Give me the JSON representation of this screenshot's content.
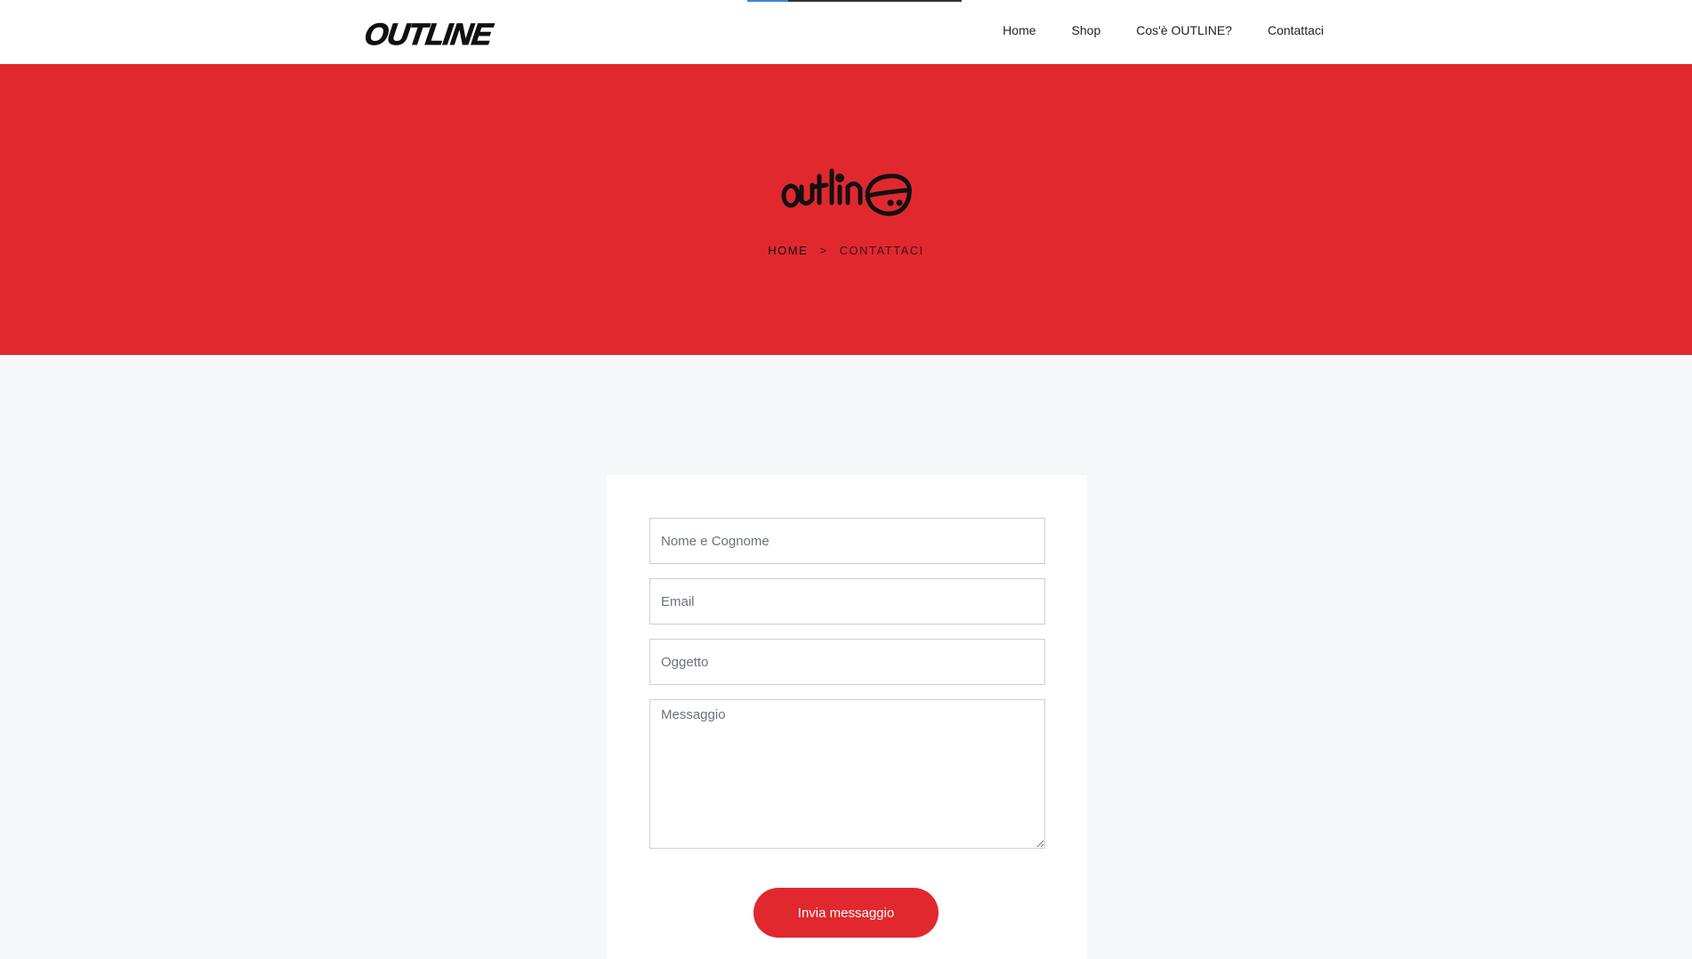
{
  "header": {
    "logo_text": "OUTLINE",
    "progress_fraction": 0.19,
    "nav": [
      {
        "label": "Home"
      },
      {
        "label": "Shop"
      },
      {
        "label": "Cos'è OUTLINE?"
      },
      {
        "label": "Contattaci"
      }
    ]
  },
  "hero": {
    "background_color": "#e1282f",
    "logo_name": "outline-graffiti-logo",
    "breadcrumb": {
      "home": "HOME",
      "separator": ">",
      "current": "CONTATTACI"
    }
  },
  "form": {
    "name_placeholder": "Nome e Cognome",
    "email_placeholder": "Email",
    "subject_placeholder": "Oggetto",
    "message_placeholder": "Messaggio",
    "submit_label": "Invia messaggio"
  },
  "colors": {
    "accent": "#e1282f",
    "progress": "#3a86d6"
  }
}
